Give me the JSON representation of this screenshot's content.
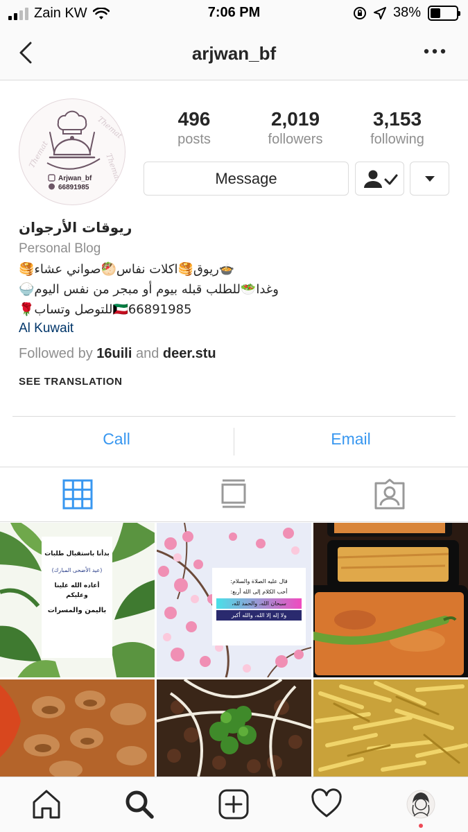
{
  "status_bar": {
    "carrier": "Zain KW",
    "time": "7:06 PM",
    "battery": "38%",
    "battery_level": 0.38,
    "icons": [
      "signal-icon",
      "wifi-icon",
      "orientation-lock-icon",
      "location-icon",
      "battery-icon"
    ]
  },
  "nav": {
    "username": "arjwan_bf",
    "icons": [
      "back-chevron-icon",
      "more-options-icon"
    ]
  },
  "avatar": {
    "logo_handle": "Arjwan_bf",
    "logo_phone": "66891985",
    "watermark": "Themat",
    "colors": {
      "ring": "#c9b3bd",
      "ink": "#6d5666"
    }
  },
  "stats": [
    {
      "value": "496",
      "label": "posts"
    },
    {
      "value": "2,019",
      "label": "followers"
    },
    {
      "value": "3,153",
      "label": "following"
    }
  ],
  "actions": {
    "message_label": "Message",
    "icons": [
      "following-person-check-icon",
      "dropdown-triangle-icon"
    ]
  },
  "bio": {
    "name": "ريوقات الأرجوان",
    "category": "Personal Blog",
    "line1": "🥞ريوق🥞اكلات نفاس🥙صواني عشاء🍲",
    "line2": "🍚وغدا🥗للطلب قبله بيوم أو مبجر من نفس اليوم",
    "line3": "🌹للتوصل وتساب🇰🇼66891985",
    "location": "Al Kuwait",
    "followed_prefix": "Followed by",
    "followed_user1": "16uili",
    "followed_and": "and",
    "followed_user2": "deer.stu",
    "translate": "SEE TRANSLATION"
  },
  "contact": {
    "call": "Call",
    "email": "Email"
  },
  "tabs": {
    "icons": [
      "grid-icon",
      "feed-list-icon",
      "tagged-person-icon"
    ],
    "active": "grid-icon",
    "active_color": "#3897f0",
    "inactive_color": "#999999"
  },
  "posts": [
    {
      "kind": "text-card-leaves",
      "lines": [
        "بدأنا باستقبال طلبات",
        "(عيد الأضحى المبارك)",
        "أعاده الله علينا وعليكم",
        "باليمن والمسرات"
      ]
    },
    {
      "kind": "text-card-blossom",
      "lines": [
        "قال عليه الصلاة والسلام:",
        "أحب الكلام إلى الله أربع:",
        "سبحان الله، والحمد لله،",
        "ولا إله إلا الله، والله أكبر"
      ]
    },
    {
      "kind": "food-photo",
      "subject": "dishes with green chili"
    },
    {
      "kind": "food-photo",
      "subject": "mushroom dish"
    },
    {
      "kind": "food-photo",
      "subject": "dish with parsley and cheese"
    },
    {
      "kind": "food-photo",
      "subject": "potato sticks"
    }
  ],
  "bottom_bar": {
    "icons": [
      "home-icon",
      "search-icon",
      "new-post-icon",
      "activity-heart-icon",
      "profile-avatar-icon"
    ],
    "active": "search-icon",
    "notification_color": "#ed4956"
  },
  "colors": {
    "link_blue": "#3897f0",
    "location_blue": "#003569",
    "muted_gray": "#8e8e8e",
    "divider": "#dbdbdb"
  }
}
